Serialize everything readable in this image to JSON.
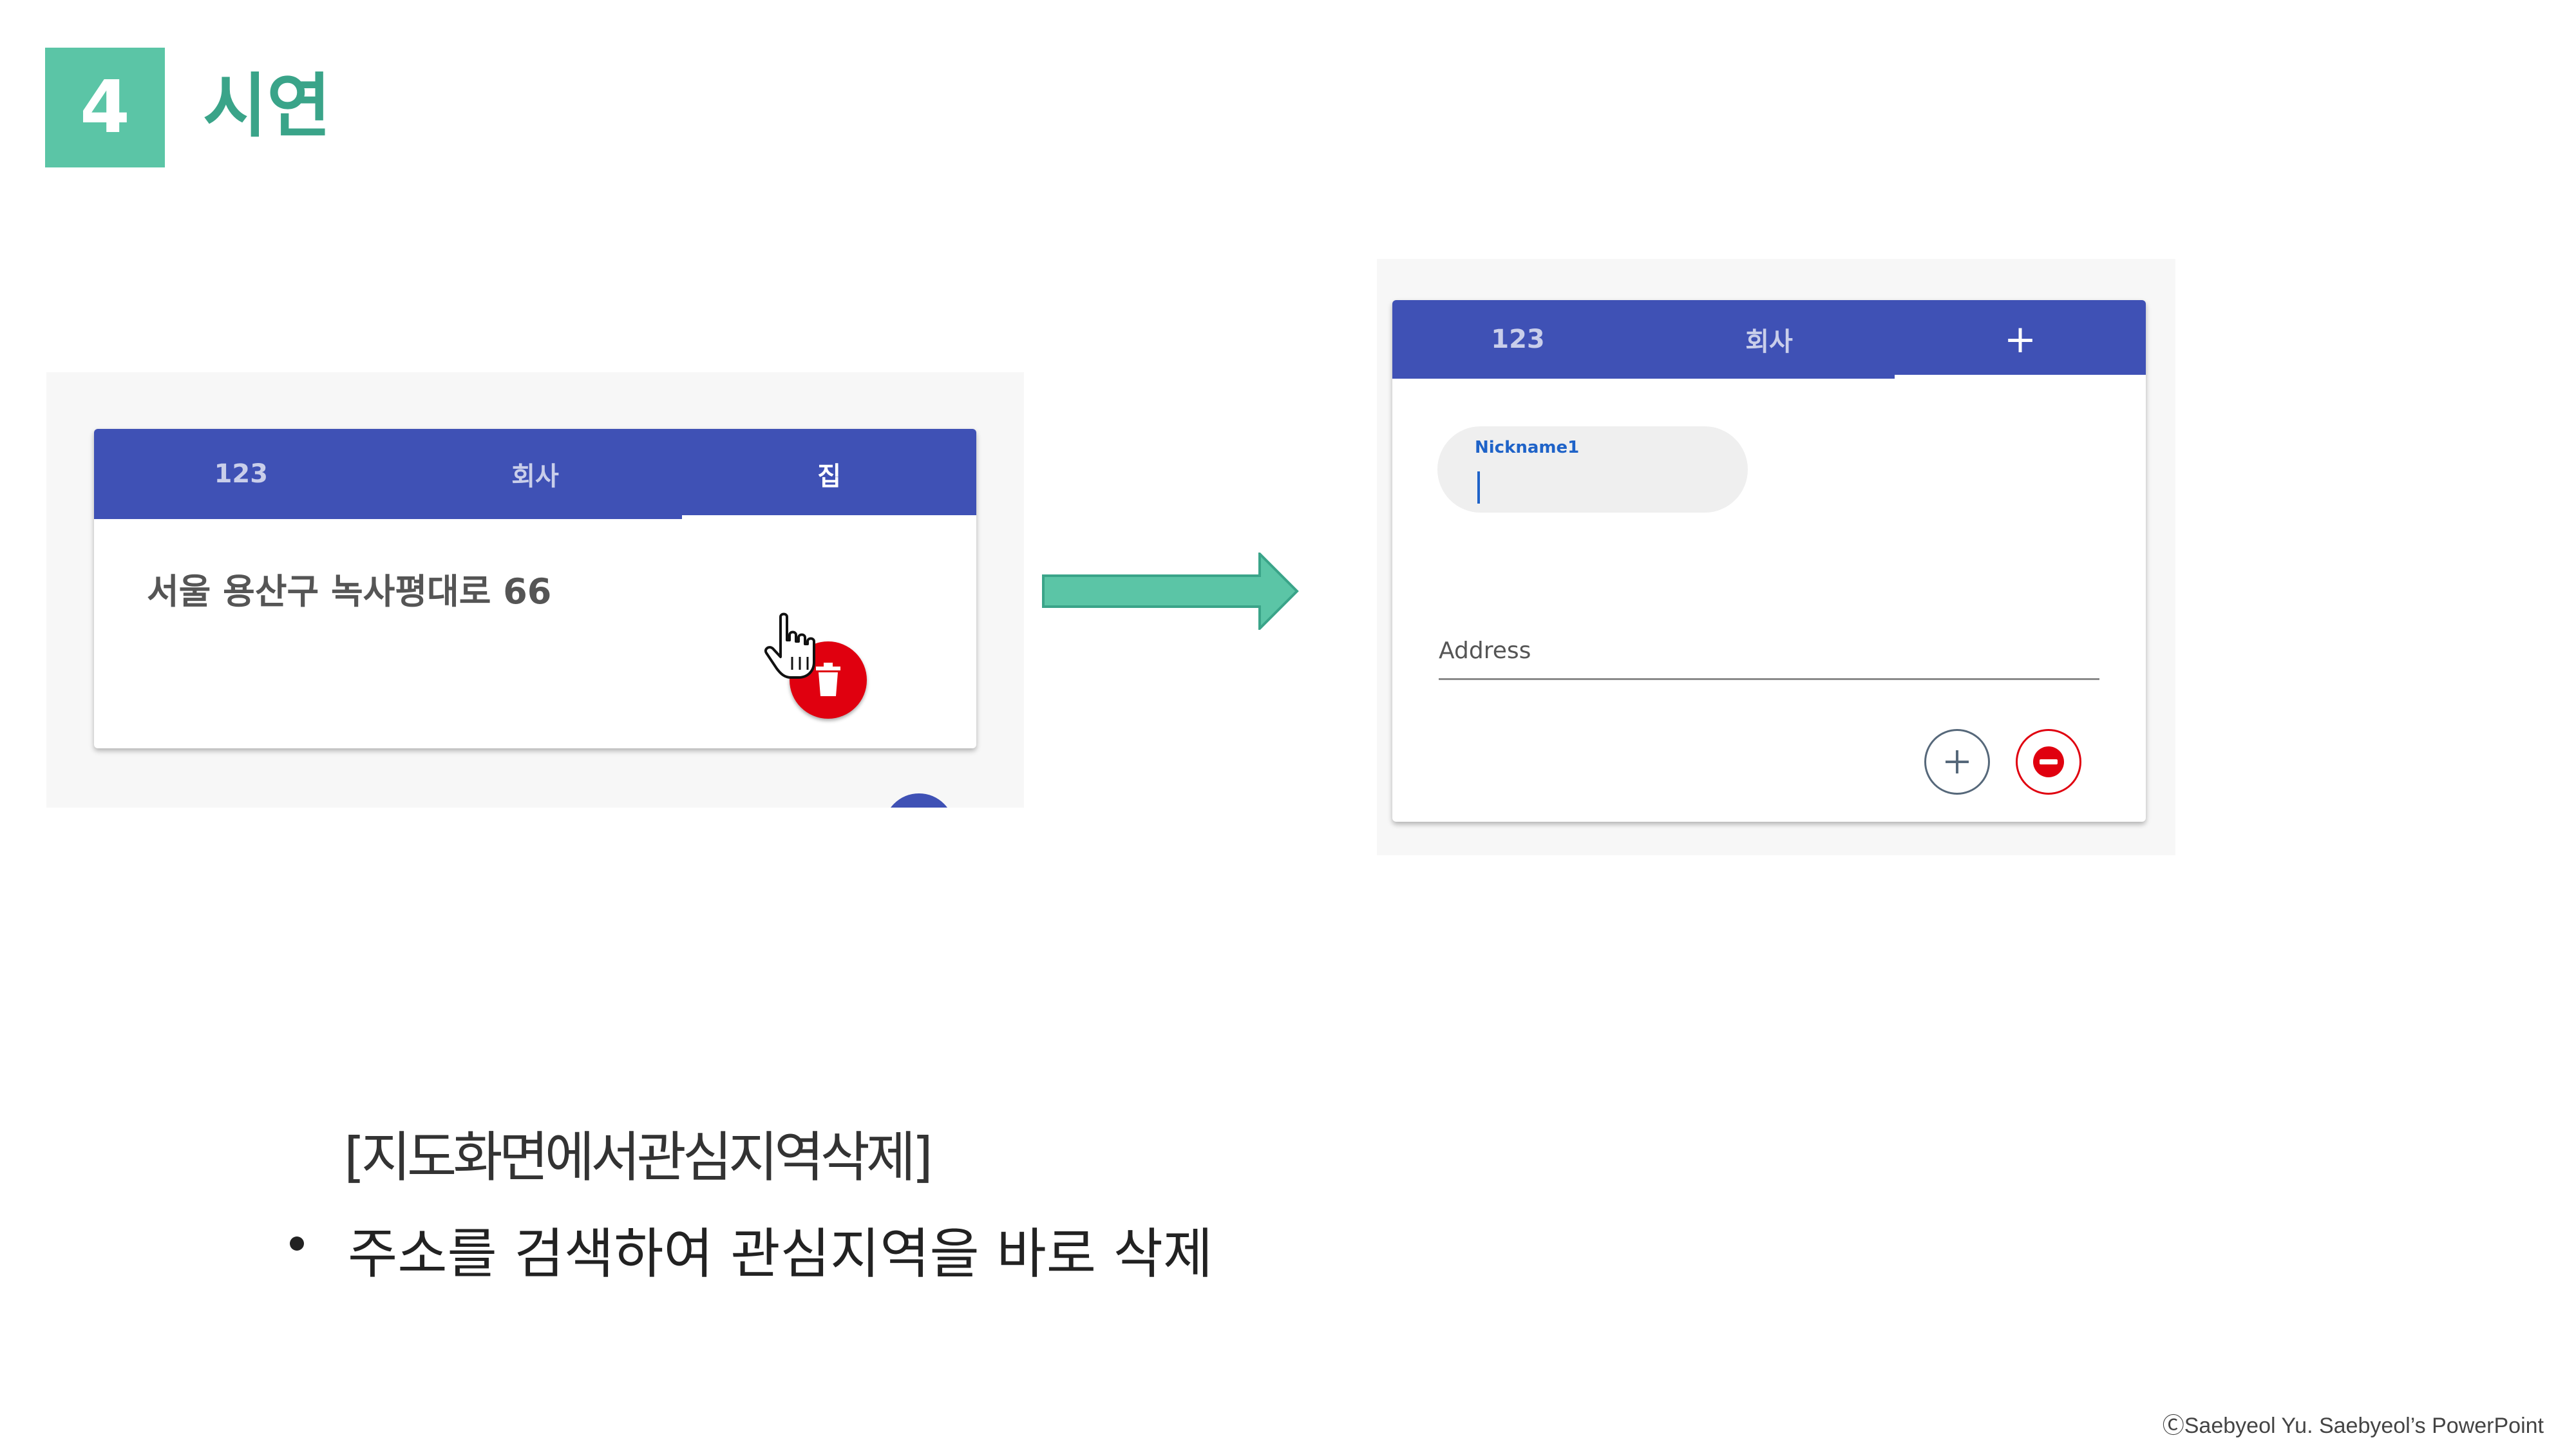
{
  "header": {
    "section_number": "4",
    "title": "시연"
  },
  "before_screen": {
    "tabs": [
      {
        "label": "123",
        "active": false
      },
      {
        "label": "회사",
        "active": false
      },
      {
        "label": "집",
        "active": true
      }
    ],
    "address": "서울 용산구 녹사평대로 66",
    "delete_button_icon": "trash-icon",
    "pointer_icon": "hand-pointer-icon"
  },
  "after_screen": {
    "tabs": [
      {
        "label": "123",
        "active": false
      },
      {
        "label": "회사",
        "active": false
      },
      {
        "label": "+",
        "active": true
      }
    ],
    "nickname_label": "Nickname1",
    "address_label": "Address",
    "add_button_icon": "plus-icon",
    "remove_button_icon": "minus-circle-icon"
  },
  "caption": {
    "title": "[지도화면에서관심지역삭제]",
    "bullet": "주소를 검색하여 관심지역을 바로 삭제"
  },
  "footer": "ⒸSaebyeol Yu. Saebyeol’s PowerPoint",
  "colors": {
    "accent": "#5bc5a6",
    "title": "#3aa489",
    "tab_bar": "#3f51b5",
    "danger": "#e0000f",
    "focus": "#1f63c8"
  }
}
